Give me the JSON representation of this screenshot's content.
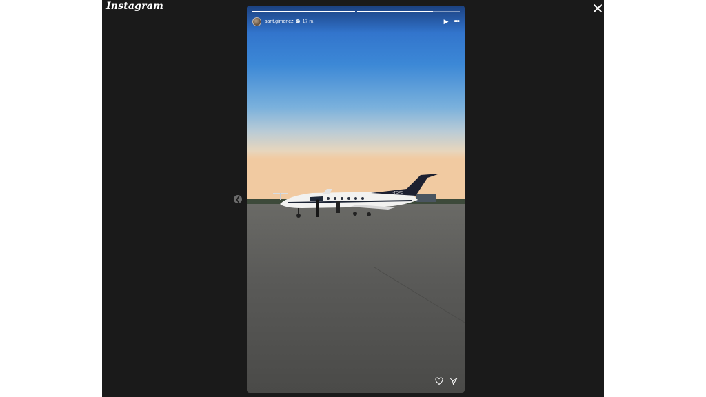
{
  "app": {
    "logo": "Instagram"
  },
  "story": {
    "username": "sant.gimenez",
    "time": "17 m.",
    "progress": {
      "segments": 2,
      "current_fill": 0.74
    },
    "image": {
      "plane_registration": "I-TOPO"
    }
  },
  "icons": {
    "close": "close-icon",
    "prev": "chevron-left-icon",
    "play": "play-icon",
    "more": "more-options-icon",
    "like": "heart-icon",
    "share": "paper-plane-icon",
    "verified": "verified-badge-icon"
  },
  "colors": {
    "viewer_bg": "#1a1a1a",
    "sky_top": "#2c6fd0",
    "sky_horizon": "#f3d6b0",
    "tarmac": "#565656"
  }
}
